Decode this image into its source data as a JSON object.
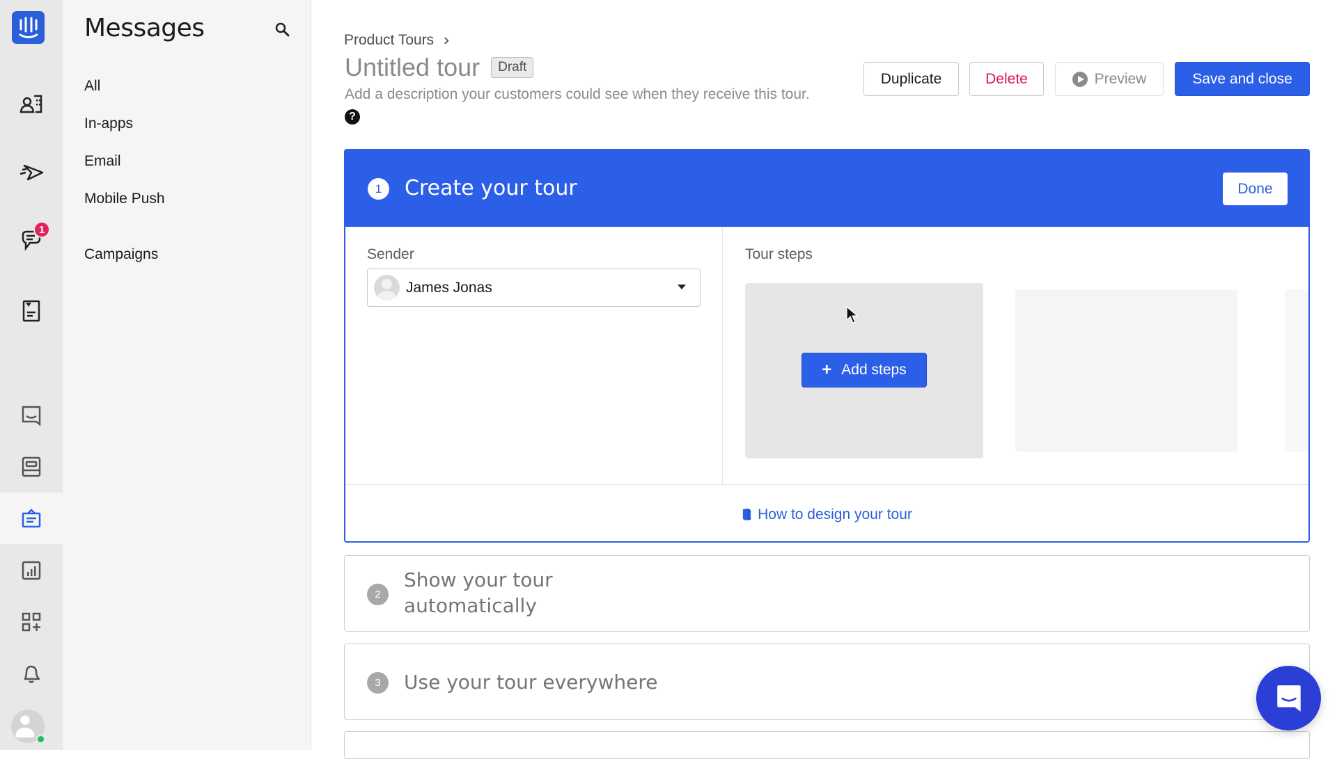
{
  "rail": {
    "logo": "intercom-logo",
    "items": [
      {
        "icon": "contacts-icon"
      },
      {
        "icon": "outbound-icon"
      },
      {
        "icon": "inbox-icon",
        "badge": "1"
      },
      {
        "icon": "articles-icon"
      },
      {
        "icon": "messenger-icon"
      },
      {
        "icon": "operator-icon"
      },
      {
        "icon": "product-tours-icon",
        "active": true
      },
      {
        "icon": "reports-icon"
      },
      {
        "icon": "app-store-icon"
      },
      {
        "icon": "notifications-icon"
      }
    ],
    "status": "online"
  },
  "sidebar": {
    "title": "Messages",
    "items": [
      {
        "label": "All"
      },
      {
        "label": "In-apps"
      },
      {
        "label": "Email"
      },
      {
        "label": "Mobile Push"
      },
      {
        "label": "Campaigns"
      }
    ]
  },
  "header": {
    "breadcrumb": "Product Tours",
    "title": "Untitled tour",
    "status_badge": "Draft",
    "description_placeholder": "Add a description your customers could see when they receive this tour.",
    "buttons": {
      "duplicate": "Duplicate",
      "delete": "Delete",
      "preview": "Preview",
      "save": "Save and close"
    }
  },
  "steps": [
    {
      "number": "1",
      "title": "Create your tour",
      "done_label": "Done",
      "sender_label": "Sender",
      "sender_value": "James Jonas",
      "tour_steps_label": "Tour steps",
      "add_steps_label": "Add steps",
      "help_link": "How to design your tour"
    },
    {
      "number": "2",
      "title_line1": "Show your tour",
      "title_line2": "automatically"
    },
    {
      "number": "3",
      "title": "Use your tour everywhere"
    }
  ],
  "colors": {
    "primary": "#2b5fe8",
    "danger": "#d8174e",
    "badge": "#e0245e",
    "messenger": "#2b3fd6",
    "online": "#1fbf5b"
  }
}
